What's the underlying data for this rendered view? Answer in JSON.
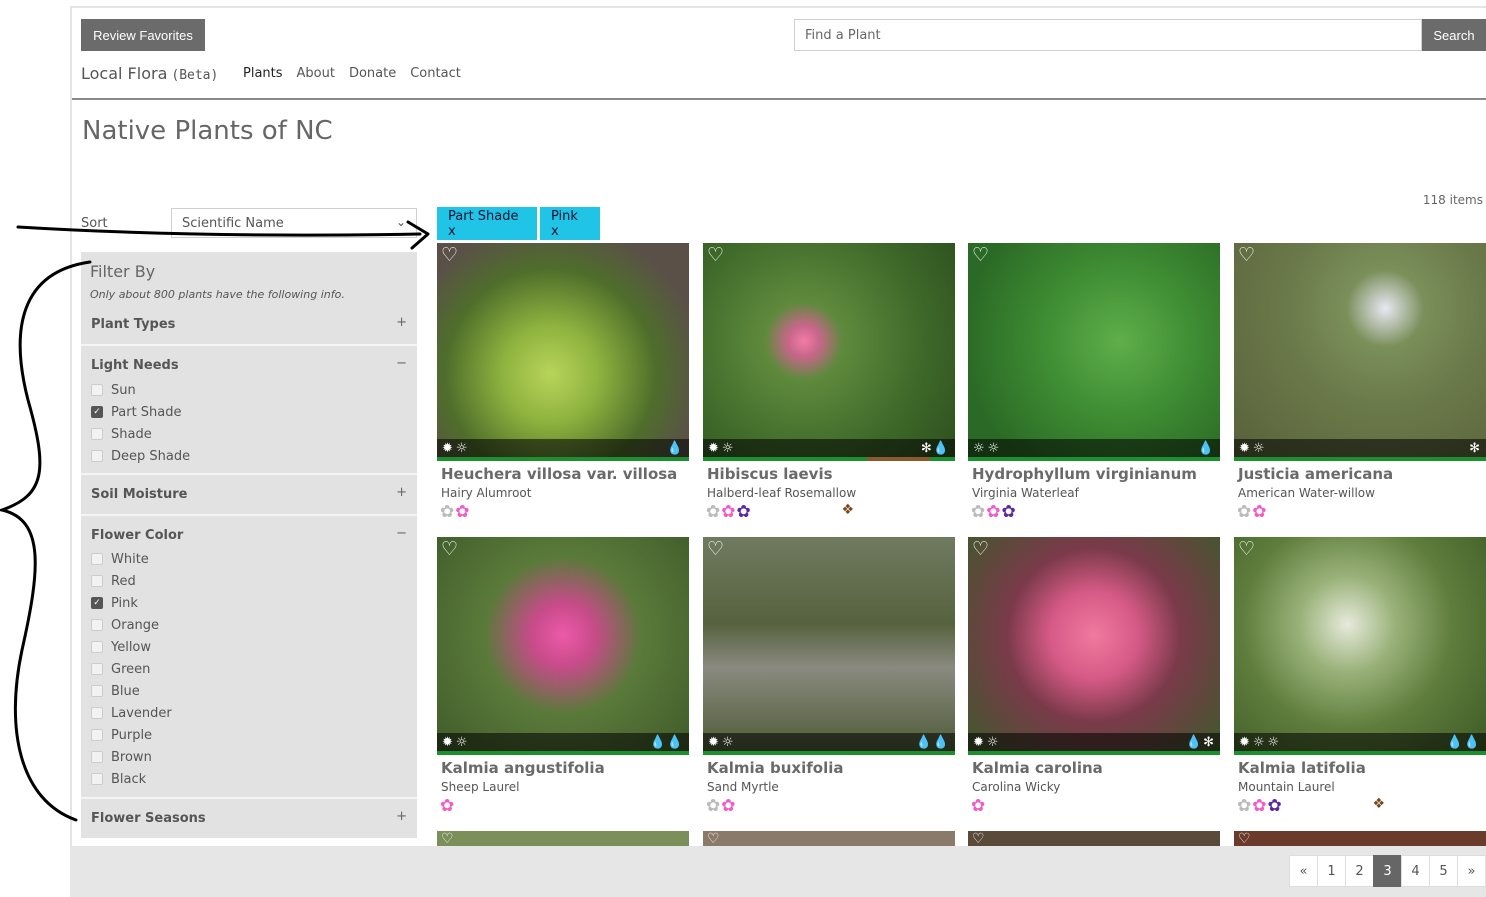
{
  "header": {
    "favorites_label": "Review Favorites",
    "search_placeholder": "Find a Plant",
    "search_label": "Search",
    "brand": "Local Flora",
    "brand_beta": "(Beta)",
    "nav": [
      "Plants",
      "About",
      "Donate",
      "Contact"
    ]
  },
  "page_title": "Native Plants of NC",
  "item_count": "118 items",
  "sort": {
    "label": "Sort",
    "value": "Scientific Name"
  },
  "active_filters": [
    "Part Shade x",
    "Pink x"
  ],
  "sidebar": {
    "title": "Filter By",
    "note": "Only about 800 plants have the following info.",
    "sections": {
      "plant_types": {
        "label": "Plant Types",
        "toggle": "+"
      },
      "light_needs": {
        "label": "Light Needs",
        "toggle": "−",
        "options": [
          "Sun",
          "Part Shade",
          "Shade",
          "Deep Shade"
        ],
        "checked": [
          "Part Shade"
        ]
      },
      "soil_moisture": {
        "label": "Soil Moisture",
        "toggle": "+"
      },
      "flower_color": {
        "label": "Flower Color",
        "toggle": "−",
        "options": [
          "White",
          "Red",
          "Pink",
          "Orange",
          "Yellow",
          "Green",
          "Blue",
          "Lavender",
          "Purple",
          "Brown",
          "Black"
        ],
        "checked": [
          "Pink"
        ]
      },
      "flower_seasons": {
        "label": "Flower Seasons",
        "toggle": "+"
      }
    }
  },
  "plants": [
    {
      "sci": "Heuchera villosa var. villosa",
      "common": "Hairy Alumroot"
    },
    {
      "sci": "Hibiscus laevis",
      "common": "Halberd-leaf Rosemallow"
    },
    {
      "sci": "Hydrophyllum virginianum",
      "common": "Virginia Waterleaf"
    },
    {
      "sci": "Justicia americana",
      "common": "American Water-willow"
    },
    {
      "sci": "Kalmia angustifolia",
      "common": "Sheep Laurel"
    },
    {
      "sci": "Kalmia buxifolia",
      "common": "Sand Myrtle"
    },
    {
      "sci": "Kalmia carolina",
      "common": "Carolina Wicky"
    },
    {
      "sci": "Kalmia latifolia",
      "common": "Mountain Laurel"
    }
  ],
  "pagination": [
    "«",
    "1",
    "2",
    "3",
    "4",
    "5",
    "»"
  ],
  "pagination_current": "3",
  "colors": {
    "chip": "#1fc4e6",
    "pink": "#f25cc8",
    "purple": "#5a2a9e",
    "ribbon": "#1c8f2e"
  },
  "icons": [
    "heart-icon",
    "sun-icon",
    "part-shade-icon",
    "water-drop-icon",
    "flower-icon",
    "leaf-icon",
    "checkbox-icon",
    "chevron-down-icon"
  ]
}
